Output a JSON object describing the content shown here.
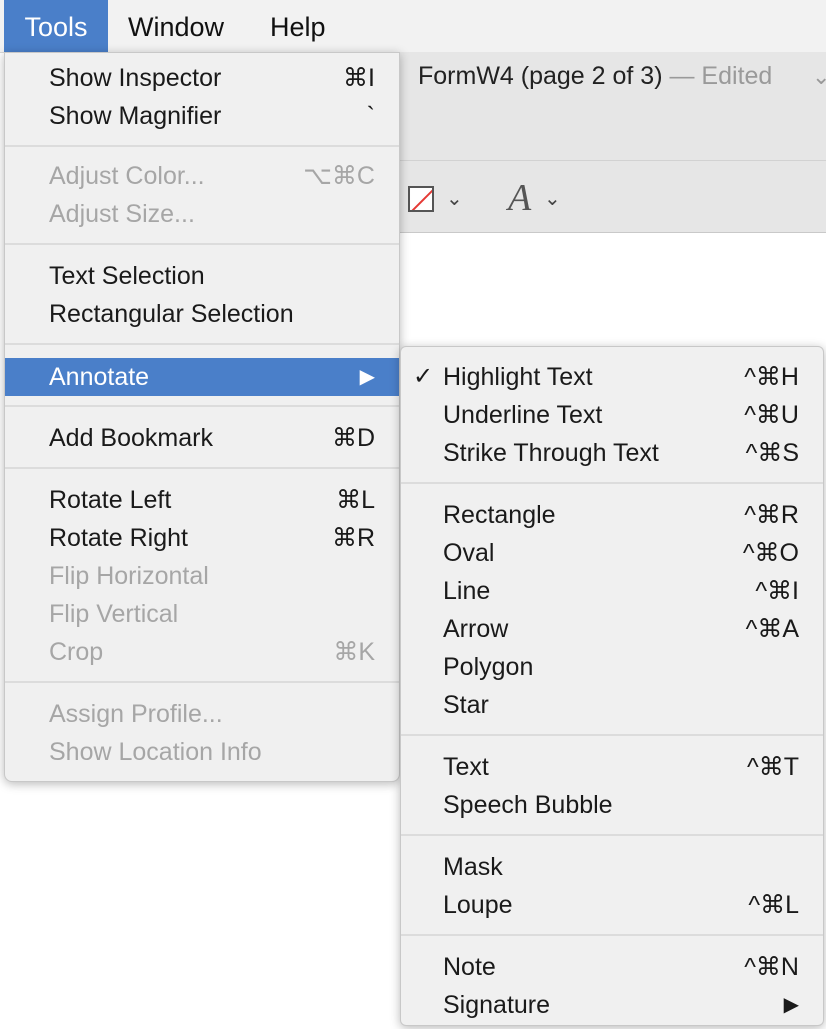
{
  "menubar": {
    "tools": "Tools",
    "window": "Window",
    "help": "Help"
  },
  "document": {
    "title": "FormW4 (page 2 of 3)",
    "edited": "— Edited",
    "chevron": "⌄",
    "font_glyph": "A"
  },
  "tools_menu": {
    "show_inspector": {
      "label": "Show Inspector",
      "shortcut": "⌘I"
    },
    "show_magnifier": {
      "label": "Show Magnifier",
      "shortcut": "`"
    },
    "adjust_color": {
      "label": "Adjust Color...",
      "shortcut": "⌥⌘C"
    },
    "adjust_size": {
      "label": "Adjust Size..."
    },
    "text_selection": {
      "label": "Text Selection"
    },
    "rect_selection": {
      "label": "Rectangular Selection"
    },
    "annotate": {
      "label": "Annotate",
      "arrow": "▶"
    },
    "add_bookmark": {
      "label": "Add Bookmark",
      "shortcut": "⌘D"
    },
    "rotate_left": {
      "label": "Rotate Left",
      "shortcut": "⌘L"
    },
    "rotate_right": {
      "label": "Rotate Right",
      "shortcut": "⌘R"
    },
    "flip_horizontal": {
      "label": "Flip Horizontal"
    },
    "flip_vertical": {
      "label": "Flip Vertical"
    },
    "crop": {
      "label": "Crop",
      "shortcut": "⌘K"
    },
    "assign_profile": {
      "label": "Assign Profile..."
    },
    "show_location": {
      "label": "Show Location Info"
    }
  },
  "annotate_menu": {
    "highlight": {
      "label": "Highlight Text",
      "shortcut": "^⌘H",
      "check": "✓"
    },
    "underline": {
      "label": "Underline Text",
      "shortcut": "^⌘U"
    },
    "strike": {
      "label": "Strike Through Text",
      "shortcut": "^⌘S"
    },
    "rectangle": {
      "label": "Rectangle",
      "shortcut": "^⌘R"
    },
    "oval": {
      "label": "Oval",
      "shortcut": "^⌘O"
    },
    "line": {
      "label": "Line",
      "shortcut": "^⌘I"
    },
    "arrow": {
      "label": "Arrow",
      "shortcut": "^⌘A"
    },
    "polygon": {
      "label": "Polygon"
    },
    "star": {
      "label": "Star"
    },
    "text": {
      "label": "Text",
      "shortcut": "^⌘T"
    },
    "speech_bubble": {
      "label": "Speech Bubble"
    },
    "mask": {
      "label": "Mask"
    },
    "loupe": {
      "label": "Loupe",
      "shortcut": "^⌘L"
    },
    "note": {
      "label": "Note",
      "shortcut": "^⌘N"
    },
    "signature": {
      "label": "Signature",
      "arrow": "▶"
    }
  },
  "colors": {
    "highlight": "#4a7fc9",
    "menu_bg": "#f0f0f0",
    "disabled_text": "#a6a6a6",
    "stroke_red": "#e53935"
  }
}
